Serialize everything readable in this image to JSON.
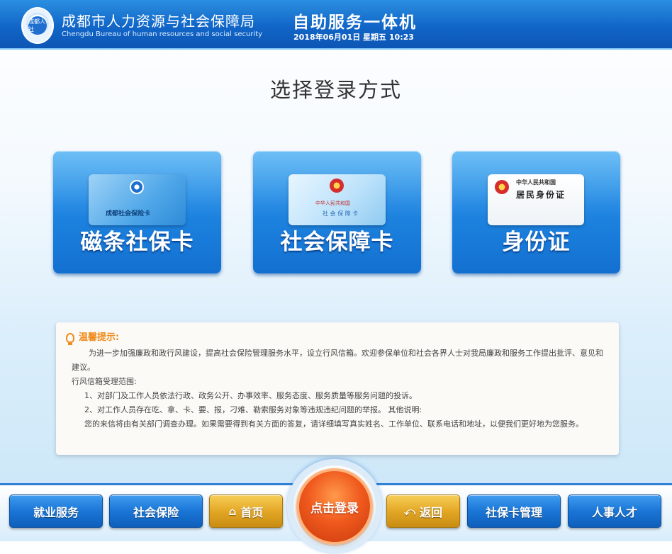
{
  "header": {
    "logo_text": "成都人社",
    "org_title": "成都市人力资源与社会保障局",
    "org_subtitle": "Chengdu Bureau of human resources and social security",
    "kiosk_title": "自助服务一体机",
    "datetime": "2018年06月01日 星期五 10:23"
  },
  "page_title": "选择登录方式",
  "cards": [
    {
      "label": "磁条社保卡",
      "image_text": "成都社会保险卡"
    },
    {
      "label": "社会保障卡",
      "image_text_1": "中华人民共和国",
      "image_text_2": "社 会 保 障 卡"
    },
    {
      "label": "身份证",
      "image_text_1": "中华人民共和国",
      "image_text_2": "居民身份证"
    }
  ],
  "notice": {
    "title": "温馨提示:",
    "para1": "为进一步加强廉政和政行风建设，提高社会保险管理服务水平，设立行风信箱。欢迎参保单位和社会各界人士对我局廉政和服务工作提出批评、意见和建议。",
    "para2": "行风信箱受理范围:",
    "item1": "1、对部门及工作人员依法行政、政务公开、办事效率、服务态度、服务质量等服务问题的投诉。",
    "item2": "2、对工作人员存在吃、拿、卡、要、报，刁难、勒索服务对象等违规违纪问题的举报。  其他说明:",
    "para3": "您的来信将由有关部门调查办理。如果需要得到有关方面的答复，请详细填写真实姓名、工作单位、联系电话和地址，以便我们更好地为您服务。"
  },
  "nav": {
    "employment": "就业服务",
    "social_insurance": "社会保险",
    "home": "首页",
    "login": "点击登录",
    "back": "返回",
    "card_management": "社保卡管理",
    "personnel": "人事人才"
  },
  "colors": {
    "header_blue": "#1166c8",
    "card_blue": "#1f86e2",
    "notice_orange": "#f08a1c",
    "login_orange": "#f05a1e",
    "gold": "#e3a726"
  },
  "icons": {
    "home": "home-icon",
    "back": "back-arrow-icon",
    "notice": "lightbulb-icon"
  }
}
